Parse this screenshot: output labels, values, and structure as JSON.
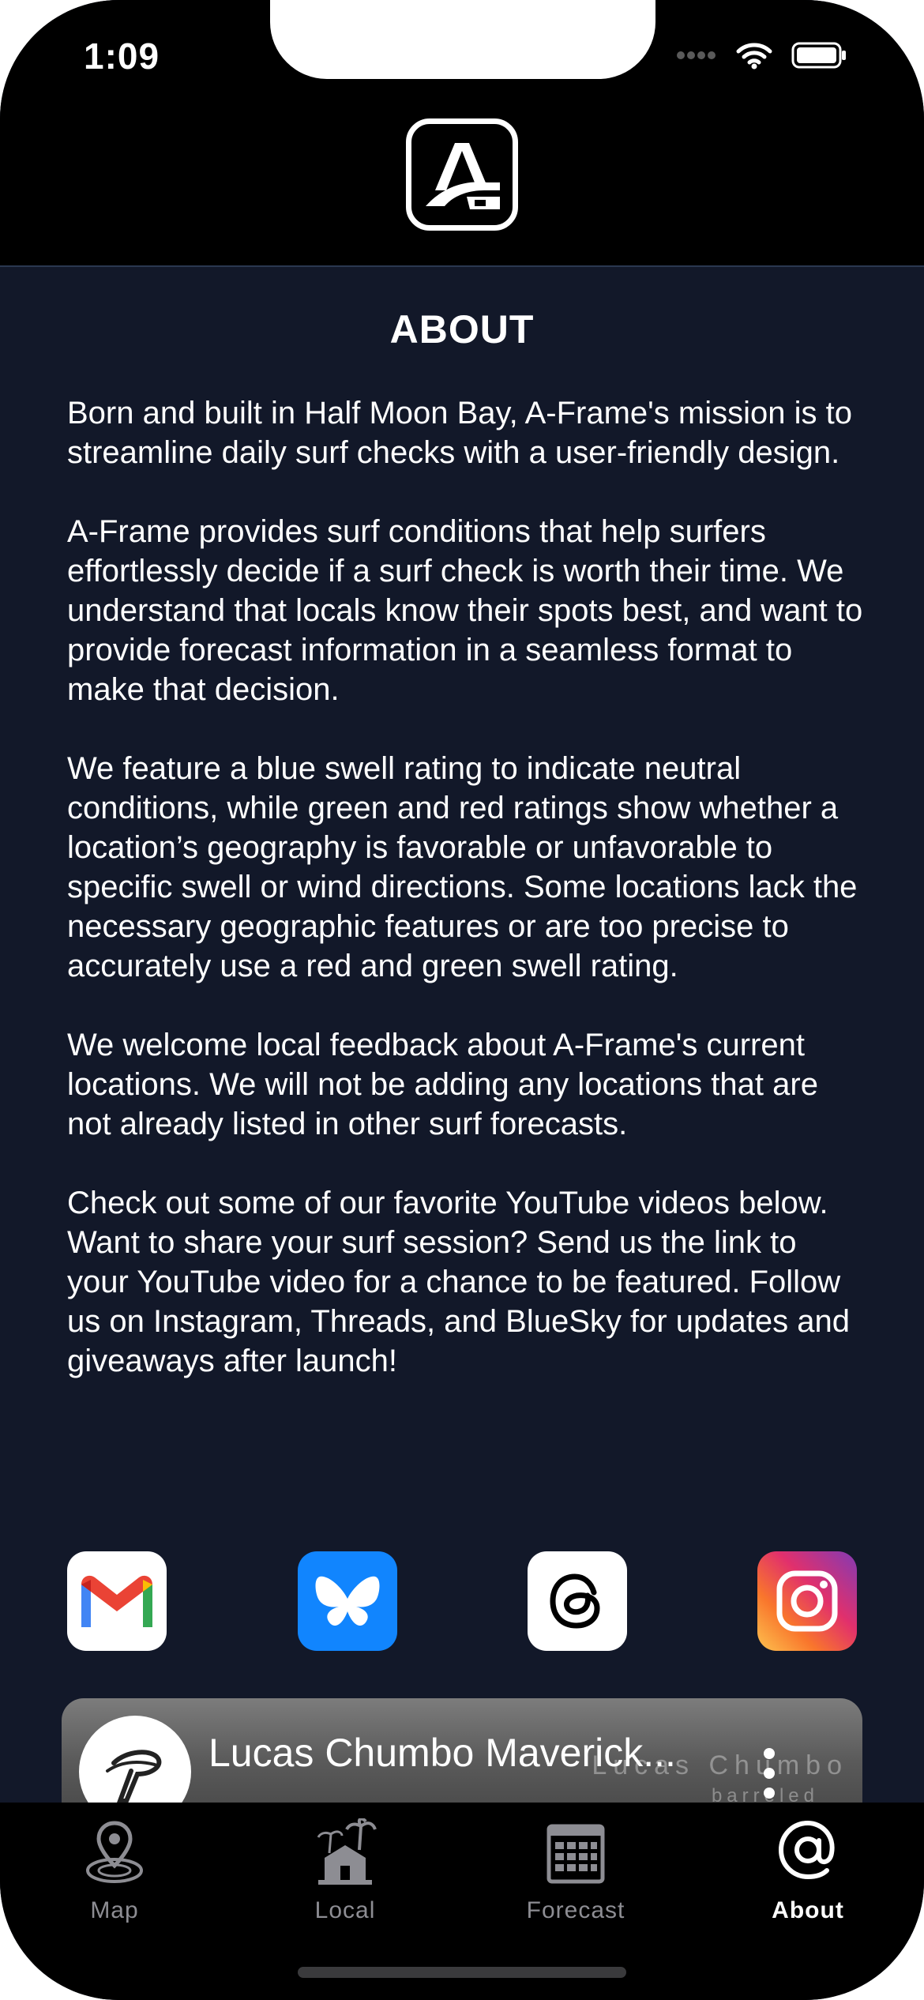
{
  "status_bar": {
    "time": "1:09"
  },
  "header": {
    "logo_icon": "a-frame-logo-icon"
  },
  "about": {
    "title": "ABOUT",
    "paragraphs": [
      "Born and built in Half Moon Bay, A-Frame's mission is to streamline daily surf checks with a user-friendly design.",
      "A-Frame provides surf conditions that help surfers effortlessly decide if a surf check is worth their time. We understand that locals know their spots best, and want to provide forecast information in a seamless format to make that decision.",
      "We feature a blue swell rating to indicate neutral conditions, while green and red ratings show whether a location’s geography is favorable or unfavorable to specific swell or wind directions. Some locations lack the necessary geographic features or are too precise to accurately use a red and green swell rating.",
      "We welcome local feedback about A-Frame's current locations. We will not be adding any locations that are not already listed in other surf forecasts.",
      "Check out some of our favorite YouTube videos below. Want to share your surf session? Send us the link to your YouTube video for a chance to be featured. Follow us on Instagram, Threads, and BlueSky for updates and giveaways after launch!"
    ]
  },
  "socials": [
    {
      "name": "gmail-icon"
    },
    {
      "name": "bluesky-icon"
    },
    {
      "name": "threads-icon"
    },
    {
      "name": "instagram-icon"
    }
  ],
  "video": {
    "title": "Lucas Chumbo Maverick...",
    "watermark": "Lucas Chumbo",
    "watermark_sub": "barreled"
  },
  "tabs": [
    {
      "label": "Map",
      "icon": "map-pin-icon",
      "active": false
    },
    {
      "label": "Local",
      "icon": "palm-tree-house-icon",
      "active": false
    },
    {
      "label": "Forecast",
      "icon": "calendar-grid-icon",
      "active": false
    },
    {
      "label": "About",
      "icon": "at-sign-icon",
      "active": true
    }
  ],
  "colors": {
    "background": "#121829",
    "header": "#000000",
    "tab_active": "#ffffff",
    "tab_inactive": "#8d8d93",
    "bluesky": "#1185fe"
  }
}
